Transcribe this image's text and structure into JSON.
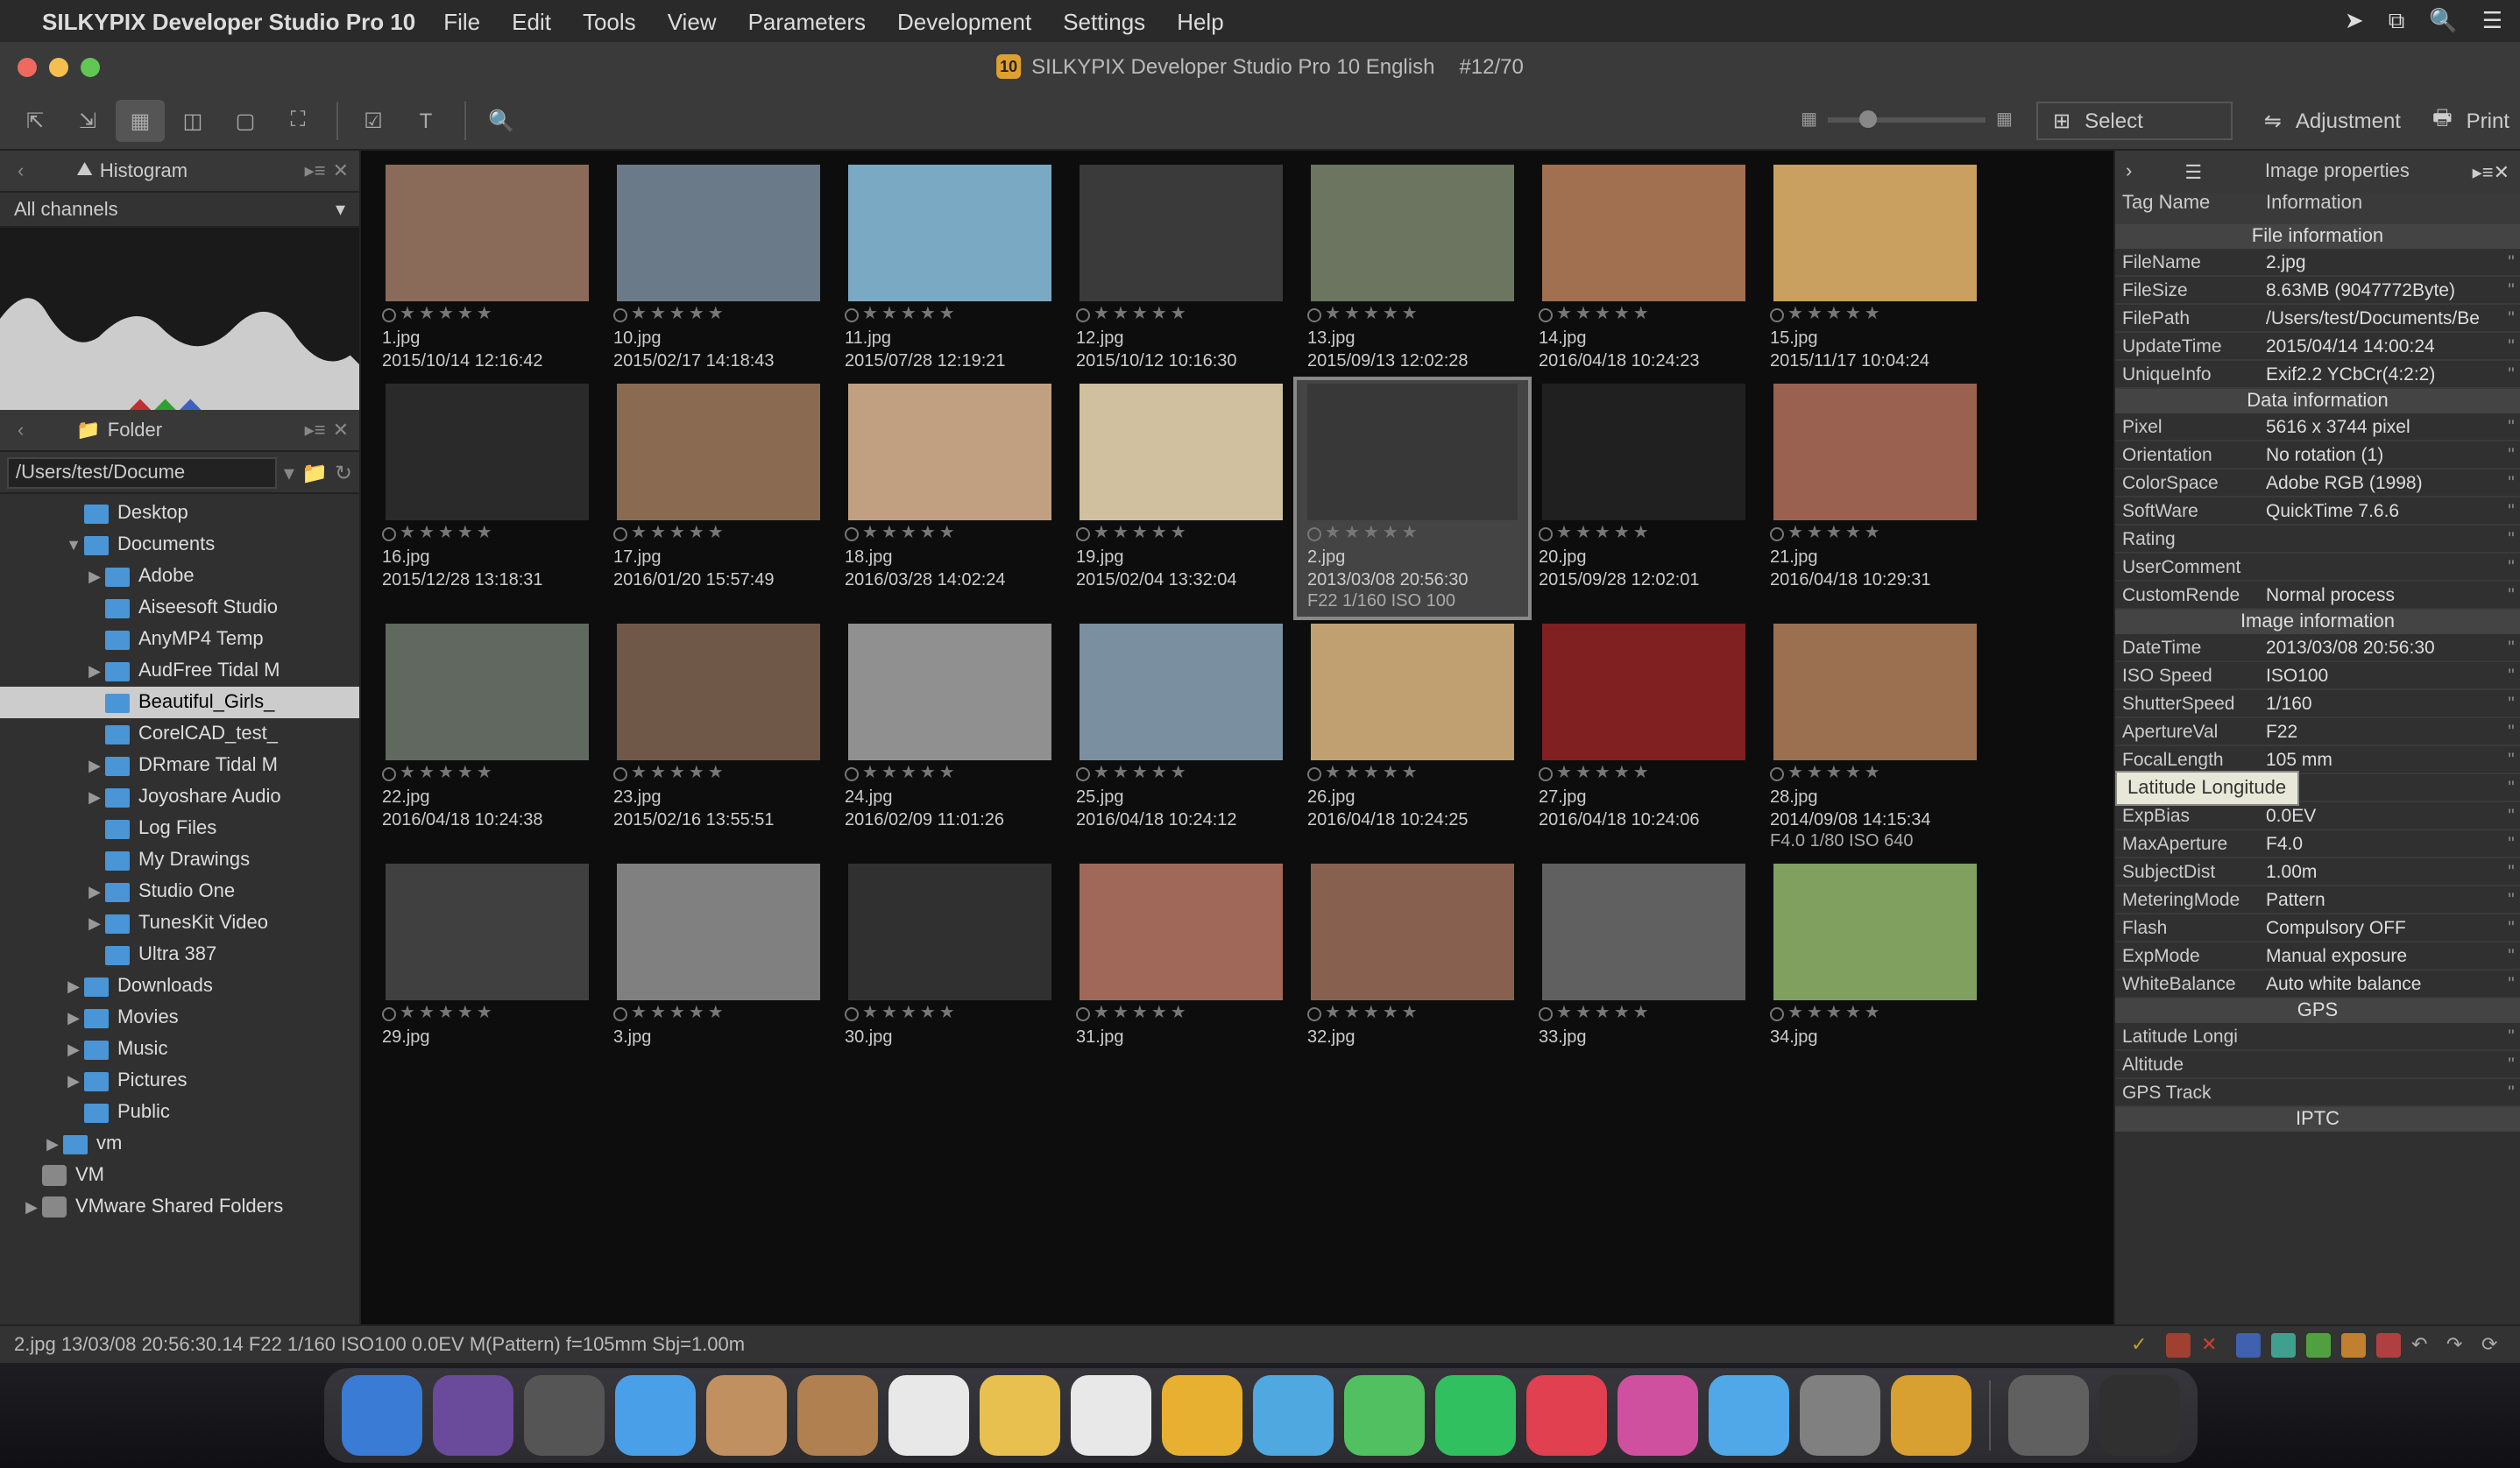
{
  "menubar": {
    "app": "SILKYPIX Developer Studio Pro 10",
    "items": [
      "File",
      "Edit",
      "Tools",
      "View",
      "Parameters",
      "Development",
      "Settings",
      "Help"
    ]
  },
  "window": {
    "title": "SILKYPIX Developer Studio Pro 10 English",
    "counter": "#12/70",
    "badge": "10"
  },
  "toolbar": {
    "select": "Select",
    "adjustment": "Adjustment",
    "print": "Print"
  },
  "histogram": {
    "title": "Histogram",
    "channels": "All channels"
  },
  "folder": {
    "title": "Folder",
    "path": "/Users/test/Docume",
    "tree": [
      {
        "label": "Desktop",
        "indent": 3,
        "arrow": ""
      },
      {
        "label": "Documents",
        "indent": 3,
        "arrow": "▼"
      },
      {
        "label": "Adobe",
        "indent": 4,
        "arrow": "▶"
      },
      {
        "label": "Aiseesoft Studio",
        "indent": 4,
        "arrow": ""
      },
      {
        "label": "AnyMP4 Temp",
        "indent": 4,
        "arrow": ""
      },
      {
        "label": "AudFree Tidal M",
        "indent": 4,
        "arrow": "▶"
      },
      {
        "label": "Beautiful_Girls_",
        "indent": 4,
        "arrow": "",
        "sel": true
      },
      {
        "label": "CorelCAD_test_",
        "indent": 4,
        "arrow": ""
      },
      {
        "label": "DRmare Tidal M",
        "indent": 4,
        "arrow": "▶"
      },
      {
        "label": "Joyoshare Audio",
        "indent": 4,
        "arrow": "▶"
      },
      {
        "label": "Log Files",
        "indent": 4,
        "arrow": ""
      },
      {
        "label": "My Drawings",
        "indent": 4,
        "arrow": ""
      },
      {
        "label": "Studio One",
        "indent": 4,
        "arrow": "▶"
      },
      {
        "label": "TunesKit Video",
        "indent": 4,
        "arrow": "▶"
      },
      {
        "label": "Ultra 387",
        "indent": 4,
        "arrow": ""
      },
      {
        "label": "Downloads",
        "indent": 3,
        "arrow": "▶"
      },
      {
        "label": "Movies",
        "indent": 3,
        "arrow": "▶"
      },
      {
        "label": "Music",
        "indent": 3,
        "arrow": "▶"
      },
      {
        "label": "Pictures",
        "indent": 3,
        "arrow": "▶"
      },
      {
        "label": "Public",
        "indent": 3,
        "arrow": ""
      },
      {
        "label": "vm",
        "indent": 2,
        "arrow": "▶"
      },
      {
        "label": "VM",
        "indent": 1,
        "arrow": "",
        "hd": true
      },
      {
        "label": "VMware Shared Folders",
        "indent": 1,
        "arrow": "▶",
        "hd": true
      }
    ]
  },
  "thumbs": [
    {
      "name": "1.jpg",
      "date": "2015/10/14 12:16:42",
      "c": "#8a6b5a"
    },
    {
      "name": "10.jpg",
      "date": "2015/02/17 14:18:43",
      "c": "#6a7a88"
    },
    {
      "name": "11.jpg",
      "date": "2015/07/28 12:19:21",
      "c": "#7aa9c4"
    },
    {
      "name": "12.jpg",
      "date": "2015/10/12 10:16:30",
      "c": "#3a3a3a"
    },
    {
      "name": "13.jpg",
      "date": "2015/09/13 12:02:28",
      "c": "#6b7560"
    },
    {
      "name": "14.jpg",
      "date": "2016/04/18 10:24:23",
      "c": "#a07050"
    },
    {
      "name": "15.jpg",
      "date": "2015/11/17 10:04:24",
      "c": "#c9a060"
    },
    {
      "name": "16.jpg",
      "date": "2015/12/28 13:18:31",
      "c": "#2a2a2a"
    },
    {
      "name": "17.jpg",
      "date": "2016/01/20 15:57:49",
      "c": "#8a6a50"
    },
    {
      "name": "18.jpg",
      "date": "2016/03/28 14:02:24",
      "c": "#c0a080"
    },
    {
      "name": "19.jpg",
      "date": "2015/02/04 13:32:04",
      "c": "#d0c0a0"
    },
    {
      "name": "2.jpg",
      "date": "2013/03/08 20:56:30",
      "extra": "F22 1/160 ISO 100",
      "sel": true,
      "c": "#383838"
    },
    {
      "name": "20.jpg",
      "date": "2015/09/28 12:02:01",
      "c": "#202020"
    },
    {
      "name": "21.jpg",
      "date": "2016/04/18 10:29:31",
      "c": "#9a6050"
    },
    {
      "name": "22.jpg",
      "date": "2016/04/18 10:24:38",
      "c": "#606860"
    },
    {
      "name": "23.jpg",
      "date": "2015/02/16 13:55:51",
      "c": "#705848"
    },
    {
      "name": "24.jpg",
      "date": "2016/02/09 11:01:26",
      "c": "#909090"
    },
    {
      "name": "25.jpg",
      "date": "2016/04/18 10:24:12",
      "c": "#7a90a0"
    },
    {
      "name": "26.jpg",
      "date": "2016/04/18 10:24:25",
      "c": "#c0a070"
    },
    {
      "name": "27.jpg",
      "date": "2016/04/18 10:24:06",
      "c": "#802020"
    },
    {
      "name": "28.jpg",
      "date": "2014/09/08 14:15:34",
      "extra": "F4.0 1/80 ISO 640",
      "c": "#9a7050"
    },
    {
      "name": "29.jpg",
      "date": "",
      "c": "#404040"
    },
    {
      "name": "3.jpg",
      "date": "",
      "c": "#808080"
    },
    {
      "name": "30.jpg",
      "date": "",
      "c": "#303030"
    },
    {
      "name": "31.jpg",
      "date": "",
      "c": "#a06858"
    },
    {
      "name": "32.jpg",
      "date": "",
      "c": "#886050"
    },
    {
      "name": "33.jpg",
      "date": "",
      "c": "#606060"
    },
    {
      "name": "34.jpg",
      "date": "",
      "c": "#80a060"
    }
  ],
  "props": {
    "title": "Image properties",
    "cols": {
      "k": "Tag Name",
      "v": "Information"
    },
    "sections": {
      "file": "File information",
      "data": "Data information",
      "image": "Image information",
      "gps": "GPS",
      "iptc": "IPTC"
    },
    "file": [
      {
        "k": "FileName",
        "v": "2.jpg"
      },
      {
        "k": "FileSize",
        "v": "8.63MB (9047772Byte)"
      },
      {
        "k": "FilePath",
        "v": "/Users/test/Documents/Be"
      },
      {
        "k": "UpdateTime",
        "v": "2015/04/14 14:00:24"
      },
      {
        "k": "UniqueInfo",
        "v": "Exif2.2 YCbCr(4:2:2)"
      }
    ],
    "data": [
      {
        "k": "Pixel",
        "v": "5616 x 3744 pixel"
      },
      {
        "k": "Orientation",
        "v": "No rotation (1)"
      },
      {
        "k": "ColorSpace",
        "v": "Adobe RGB (1998)"
      },
      {
        "k": "SoftWare",
        "v": "QuickTime 7.6.6"
      },
      {
        "k": "Rating",
        "v": ""
      },
      {
        "k": "UserComment",
        "v": ""
      },
      {
        "k": "CustomRende",
        "v": "Normal process"
      }
    ],
    "image": [
      {
        "k": "DateTime",
        "v": "2013/03/08 20:56:30"
      },
      {
        "k": "ISO Speed",
        "v": "ISO100"
      },
      {
        "k": "ShutterSpeed",
        "v": "1/160"
      },
      {
        "k": "ApertureVal",
        "v": "F22"
      },
      {
        "k": "FocalLength",
        "v": "105 mm"
      },
      {
        "k": "",
        "v": "ual",
        "tooltip": "Latitude Longitude"
      },
      {
        "k": "ExpBias",
        "v": "0.0EV"
      },
      {
        "k": "MaxAperture",
        "v": "F4.0"
      },
      {
        "k": "SubjectDist",
        "v": "1.00m"
      },
      {
        "k": "MeteringMode",
        "v": "Pattern"
      },
      {
        "k": "Flash",
        "v": "Compulsory OFF"
      },
      {
        "k": "ExpMode",
        "v": "Manual exposure"
      },
      {
        "k": "WhiteBalance",
        "v": "Auto white balance"
      }
    ],
    "gps": [
      {
        "k": "Latitude Longi",
        "v": ""
      },
      {
        "k": "Altitude",
        "v": ""
      },
      {
        "k": "GPS Track",
        "v": ""
      }
    ]
  },
  "status": {
    "text": "2.jpg 13/03/08 20:56:30.14 F22 1/160 ISO100  0.0EV M(Pattern) f=105mm Sbj=1.00m"
  },
  "dock_colors": [
    "#3a7bd5",
    "#6a4a9a",
    "#555",
    "#4aa0e8",
    "#c09060",
    "#b08050",
    "#e8e8e8",
    "#e8c050",
    "#e8e8e8",
    "#e8b030",
    "#50a8e0",
    "#50c060",
    "#30c060",
    "#e04050",
    "#d050a0",
    "#50a8e8",
    "#808080",
    "#d8a030",
    "#606060",
    "#303030"
  ]
}
